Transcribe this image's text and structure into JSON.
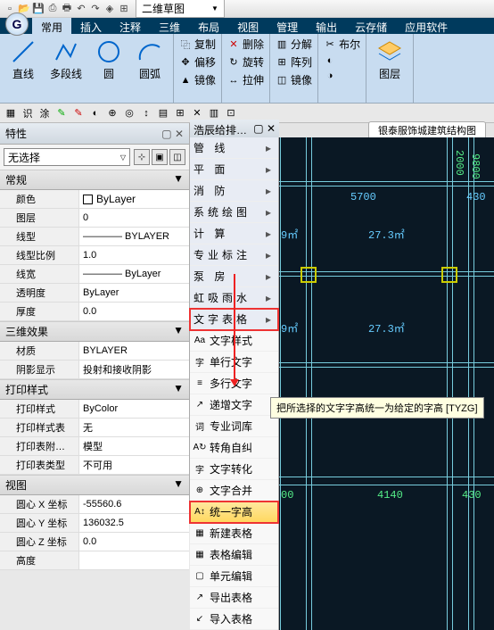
{
  "titlebar": {
    "combo": "二维草图"
  },
  "tabs": [
    "常用",
    "插入",
    "注释",
    "三维",
    "布局",
    "视图",
    "管理",
    "输出",
    "云存储",
    "应用软件"
  ],
  "active_tab": 0,
  "ribbon": {
    "line": "直线",
    "polyline": "多段线",
    "circle": "圆",
    "arc": "圆弧",
    "copy": "复制",
    "mirror": "镜像",
    "offset": "分解",
    "move": "偏移",
    "rotate": "旋转",
    "delete": "删除",
    "array": "阵列",
    "stretch": "拉伸",
    "fillet": "布尔",
    "scale": "镜像",
    "layer": "图层"
  },
  "properties": {
    "title": "特性",
    "selection": "无选择",
    "sections": {
      "general": "常规",
      "effects": "三维效果",
      "print": "打印样式",
      "view": "视图"
    },
    "rows": {
      "color_k": "颜色",
      "color_v": "ByLayer",
      "layer_k": "图层",
      "layer_v": "0",
      "linetype_k": "线型",
      "linetype_v": "———— BYLAYER",
      "ltscale_k": "线型比例",
      "ltscale_v": "1.0",
      "lweight_k": "线宽",
      "lweight_v": "———— ByLayer",
      "trans_k": "透明度",
      "trans_v": "ByLayer",
      "thick_k": "厚度",
      "thick_v": "0.0",
      "mat_k": "材质",
      "mat_v": "BYLAYER",
      "shadow_k": "阴影显示",
      "shadow_v": "投射和接收阴影",
      "pstyle_k": "打印样式",
      "pstyle_v": "ByColor",
      "pstylet_k": "打印样式表",
      "pstylet_v": "无",
      "pstylea_k": "打印表附…",
      "pstylea_v": "模型",
      "pstylety_k": "打印表类型",
      "pstylety_v": "不可用",
      "cx_k": "圆心 X 坐标",
      "cx_v": "-55560.6",
      "cy_k": "圆心 Y 坐标",
      "cy_v": "136032.5",
      "cz_k": "圆心 Z 坐标",
      "cz_v": "0.0",
      "h_k": "高度"
    }
  },
  "side_panel": {
    "title": "浩辰给排…",
    "items": [
      {
        "label": "管    线",
        "hdr": true
      },
      {
        "label": "平    面",
        "hdr": true
      },
      {
        "label": "消    防",
        "hdr": true
      },
      {
        "label": "系统绘图",
        "hdr": true
      },
      {
        "label": "计    算",
        "hdr": true
      },
      {
        "label": "专业标注",
        "hdr": true
      },
      {
        "label": "泵    房",
        "hdr": true
      },
      {
        "label": "虹吸雨水",
        "hdr": true
      },
      {
        "label": "文字表格",
        "hdr": true,
        "hl": "red"
      },
      {
        "label": "文字样式",
        "ic": "Aa"
      },
      {
        "label": "单行文字",
        "ic": "字"
      },
      {
        "label": "多行文字",
        "ic": "≡"
      },
      {
        "label": "递增文字",
        "ic": "↗"
      },
      {
        "label": "专业词库",
        "ic": "词"
      },
      {
        "label": "转角自纠",
        "ic": "A↻"
      },
      {
        "label": "文字转化",
        "ic": "字"
      },
      {
        "label": "文字合并",
        "ic": "⊕"
      },
      {
        "label": "统一字高",
        "ic": "A↕",
        "hl": "orange"
      },
      {
        "label": "新建表格",
        "ic": "▦"
      },
      {
        "label": "表格编辑",
        "ic": "▦"
      },
      {
        "label": "单元编辑",
        "ic": "▢"
      },
      {
        "label": "导出表格",
        "ic": "↗"
      },
      {
        "label": "导入表格",
        "ic": "↙"
      }
    ]
  },
  "doc_tab": "银泰服饰城建筑结构图",
  "canvas": {
    "dims": [
      "2000",
      "5700",
      "430",
      "27.3㎡",
      "9㎡",
      "27.3㎡",
      "9㎡",
      "00",
      "4140",
      "430",
      "9800"
    ]
  },
  "tooltip": "把所选择的文字字高统一为给定的字高 [TYZG]"
}
